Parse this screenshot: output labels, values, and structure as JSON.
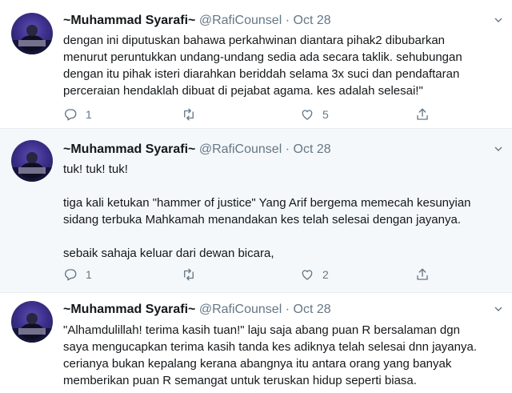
{
  "tweets": [
    {
      "name": "~Muhammad Syarafi~",
      "handle": "@RafiCounsel",
      "sep": "·",
      "date": "Oct 28",
      "lines": [
        "dengan ini diputuskan bahawa perkahwinan diantara pihak2 dibubarkan",
        "menurut peruntukkan undang-undang sedia ada secara taklik. sehubungan",
        "dengan itu pihak isteri diarahkan beriddah selama 3x suci dan pendaftaran",
        "perceraian hendaklah dibuat di pejabat agama. kes adalah selesai!\""
      ],
      "replies": "1",
      "retweets": "",
      "likes": "5"
    },
    {
      "name": "~Muhammad Syarafi~",
      "handle": "@RafiCounsel",
      "sep": "·",
      "date": "Oct 28",
      "lines": [
        "tuk! tuk! tuk!",
        "",
        "tiga kali ketukan \"hammer of justice\" Yang Arif bergema memecah kesunyian",
        "sidang terbuka Mahkamah menandakan kes telah selesai dengan jayanya.",
        "",
        "sebaik sahaja keluar dari dewan bicara,"
      ],
      "replies": "1",
      "retweets": "",
      "likes": "2"
    },
    {
      "name": "~Muhammad Syarafi~",
      "handle": "@RafiCounsel",
      "sep": "·",
      "date": "Oct 28",
      "lines": [
        "\"Alhamdulillah! terima kasih tuan!\" laju saja abang puan R bersalaman dgn",
        "saya mengucapkan terima kasih tanda kes adiknya telah selesai dnn jayanya.",
        "cerianya bukan kepalang kerana abangnya itu antara orang yang banyak",
        "memberikan puan R semangat untuk teruskan hidup seperti biasa."
      ]
    }
  ],
  "icons": {
    "reply": "reply-icon",
    "retweet": "retweet-icon",
    "like": "heart-icon",
    "share": "share-icon",
    "more": "chevron-down-icon"
  },
  "colors": {
    "text": "#14171a",
    "muted": "#657786",
    "highlight_bg": "#f5f8fa",
    "divider": "#e6ecf0"
  }
}
